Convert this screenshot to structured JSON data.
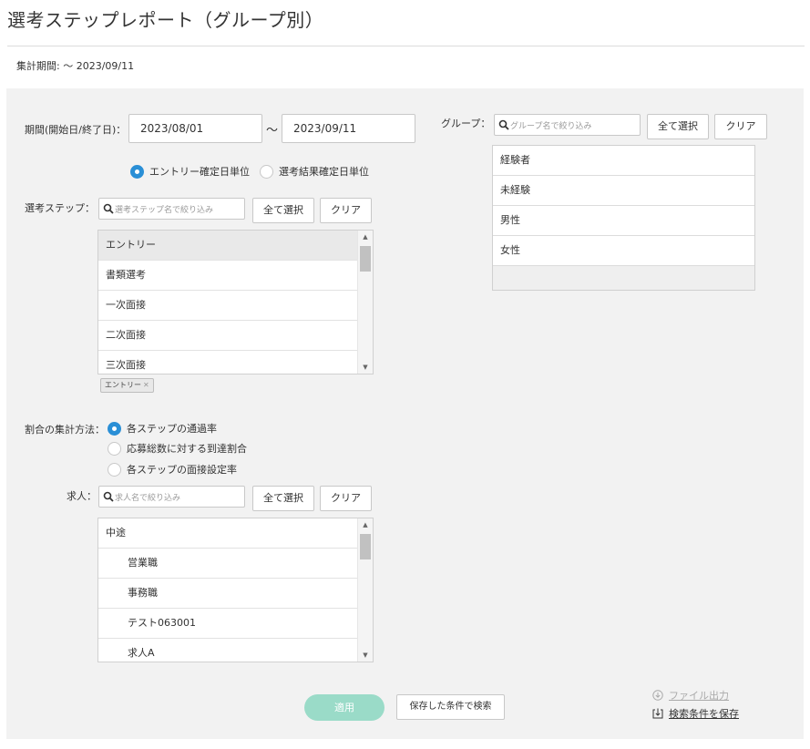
{
  "header": {
    "title": "選考ステップレポート（グループ別）",
    "period_summary": "集計期間: 〜 2023/09/11"
  },
  "period": {
    "label": "期間(開始日/終了日)：",
    "start": "2023/08/01",
    "separator": "〜",
    "end": "2023/09/11",
    "unit_options": [
      {
        "label": "エントリー確定日単位",
        "selected": true
      },
      {
        "label": "選考結果確定日単位",
        "selected": false
      }
    ]
  },
  "steps": {
    "label": "選考ステップ：",
    "search_placeholder": "選考ステップ名で絞り込み",
    "select_all": "全て選択",
    "clear": "クリア",
    "items": [
      {
        "label": "エントリー",
        "selected": true
      },
      {
        "label": "書類選考",
        "selected": false
      },
      {
        "label": "一次面接",
        "selected": false
      },
      {
        "label": "二次面接",
        "selected": false
      },
      {
        "label": "三次面接",
        "selected": false
      }
    ],
    "selected_tags": [
      "エントリー"
    ],
    "tag_remove": "✕"
  },
  "ratio": {
    "label": "割合の集計方法：",
    "options": [
      {
        "label": "各ステップの通過率",
        "selected": true
      },
      {
        "label": "応募総数に対する到達割合",
        "selected": false
      },
      {
        "label": "各ステップの面接設定率",
        "selected": false
      }
    ]
  },
  "jobs": {
    "label": "求人：",
    "search_placeholder": "求人名で絞り込み",
    "select_all": "全て選択",
    "clear": "クリア",
    "items": [
      {
        "label": "中途",
        "indent": false
      },
      {
        "label": "営業職",
        "indent": true
      },
      {
        "label": "事務職",
        "indent": true
      },
      {
        "label": "テスト063001",
        "indent": true
      },
      {
        "label": "求人A",
        "indent": true
      }
    ]
  },
  "group": {
    "label": "グループ：",
    "search_placeholder": "グループ名で絞り込み",
    "select_all": "全て選択",
    "clear": "クリア",
    "items": [
      "経験者",
      "未経験",
      "男性",
      "女性"
    ]
  },
  "footer": {
    "apply": "適用",
    "search_saved": "保存した条件で検索",
    "export_file": "ファイル出力",
    "save_conditions": "検索条件を保存"
  },
  "colors": {
    "radio_selected": "#2a8fd6",
    "apply_button": "#9adbc8",
    "panel_bg": "#f2f2f2"
  },
  "icons": {
    "search": "search-icon",
    "scroll_up": "▲",
    "scroll_down": "▼",
    "download": "download-circle-icon",
    "save": "save-download-icon"
  }
}
